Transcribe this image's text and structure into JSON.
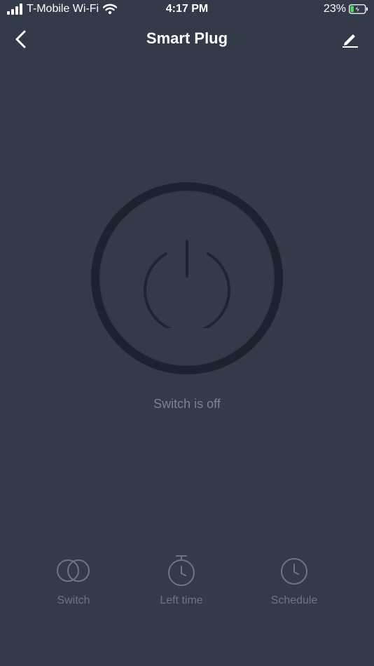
{
  "status_bar": {
    "carrier": "T-Mobile Wi-Fi",
    "time": "4:17 PM",
    "battery_percent": "23%",
    "battery_level": 0.23,
    "icons": [
      "signal-icon",
      "wifi-icon",
      "battery-charging-icon"
    ]
  },
  "nav": {
    "title": "Smart Plug",
    "back_icon": "chevron-left-icon",
    "edit_icon": "pencil-icon"
  },
  "power": {
    "icon": "power-icon",
    "status_text": "Switch is off"
  },
  "tabs": [
    {
      "label": "Switch",
      "icon": "switch-circles-icon"
    },
    {
      "label": "Left time",
      "icon": "timer-icon"
    },
    {
      "label": "Schedule",
      "icon": "clock-icon"
    }
  ],
  "colors": {
    "background": "#333a4a",
    "ring": "#1d232e",
    "muted_text": "#7b8293",
    "icon_gray": "#6d7485"
  }
}
